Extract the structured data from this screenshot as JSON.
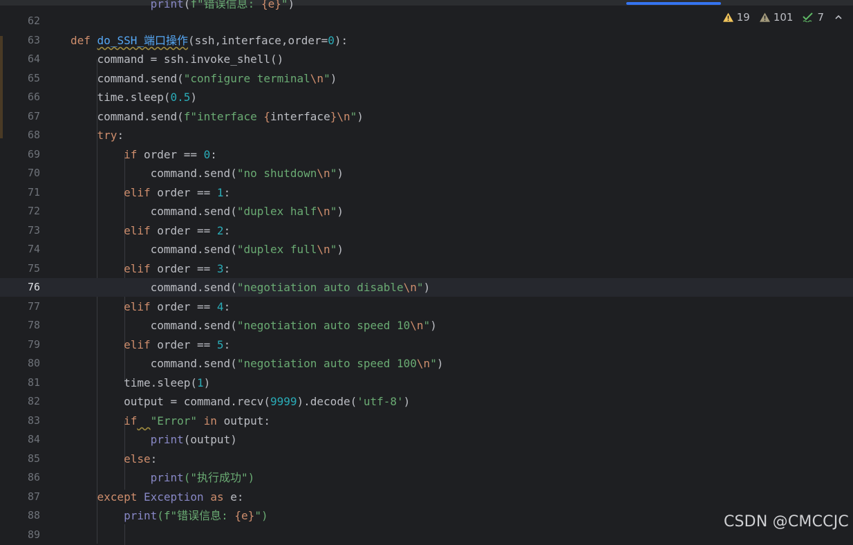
{
  "editor": {
    "current_line": "76",
    "top_partial_line": "            print(f\"错误信息: {e}\")",
    "lines": [
      {
        "n": "62"
      },
      {
        "n": "63"
      },
      {
        "n": "64"
      },
      {
        "n": "65"
      },
      {
        "n": "66"
      },
      {
        "n": "67"
      },
      {
        "n": "68"
      },
      {
        "n": "69"
      },
      {
        "n": "70"
      },
      {
        "n": "71"
      },
      {
        "n": "72"
      },
      {
        "n": "73"
      },
      {
        "n": "74"
      },
      {
        "n": "75"
      },
      {
        "n": "76"
      },
      {
        "n": "77"
      },
      {
        "n": "78"
      },
      {
        "n": "79"
      },
      {
        "n": "80"
      },
      {
        "n": "81"
      },
      {
        "n": "82"
      },
      {
        "n": "83"
      },
      {
        "n": "84"
      },
      {
        "n": "85"
      },
      {
        "n": "86"
      },
      {
        "n": "87"
      },
      {
        "n": "88"
      },
      {
        "n": "89"
      }
    ],
    "tokens": {
      "def": "def",
      "fn_name": "do_SSH_端口操作",
      "params": "(ssh,interface,order=",
      "zero": "0",
      "params_end": "):",
      "l64": "command = ssh.invoke_shell()",
      "send": "command.send(",
      "s65": "\"configure terminal",
      "esc_n": "\\n",
      "quote": "\"",
      "close": ")",
      "sleep": "time.sleep(",
      "n05": "0.5",
      "s67a": "f\"interface ",
      "s67b": "{",
      "s67c": "interface",
      "s67d": "}",
      "try": "try",
      "colon": ":",
      "if": "if",
      "elif": "elif",
      "order_eq": " order == ",
      "n0": "0",
      "n1": "1",
      "n2": "2",
      "n3": "3",
      "n4": "4",
      "n5": "5",
      "s70": "\"no shutdown",
      "s72": "\"duplex half",
      "s74": "\"duplex full",
      "s76": "\"negotiation auto disable",
      "s78": "\"negotiation auto speed 10",
      "s80": "\"negotiation auto speed 100",
      "n1b": "1",
      "output_eq": "output = command.recv(",
      "n9999": "9999",
      "decode": ").decode(",
      "utf8": "'utf-8'",
      "error": "\"Error\"",
      "in": "in",
      "output_colon": " output:",
      "print": "print",
      "print_output": "(output)",
      "else": "else",
      "s86": "(\"执行成功\")",
      "except": "except",
      "exception": "Exception",
      "as": "as",
      "e_colon": " e:",
      "s88a": "(f\"错误信息: ",
      "s88b": "{e}",
      "s88c": "\")"
    }
  },
  "inspections": {
    "warnings": "19",
    "weak_warnings": "101",
    "typos": "7"
  },
  "watermark": "CSDN @CMCCJC",
  "colors": {
    "background": "#1e1f22",
    "keyword": "#cf8e6d",
    "function": "#56a8f5",
    "string": "#6aab73",
    "number": "#2aacb8",
    "builtin": "#8888c6"
  }
}
